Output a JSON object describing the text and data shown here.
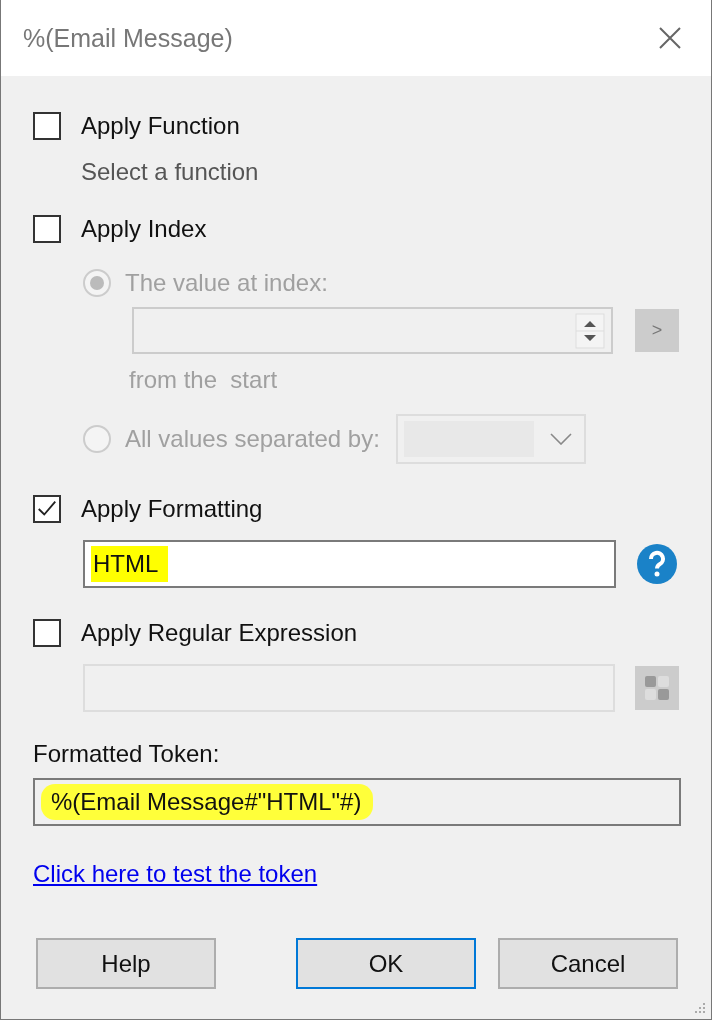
{
  "window": {
    "title": "%(Email Message)"
  },
  "apply_function": {
    "label": "Apply Function",
    "checked": false,
    "hint": "Select a function"
  },
  "apply_index": {
    "label": "Apply Index",
    "checked": false,
    "radios": [
      {
        "label": "The value at index:",
        "selected": true
      },
      {
        "label": "All values separated by:",
        "selected": false
      }
    ],
    "from_text": "from the  start",
    "next_button": ">"
  },
  "apply_formatting": {
    "label": "Apply Formatting",
    "checked": true,
    "value": "HTML",
    "highlighted": true
  },
  "apply_regex": {
    "label": "Apply Regular Expression",
    "checked": false
  },
  "formatted_token": {
    "label": "Formatted Token:",
    "value": "%(Email Message#\"HTML\"#)",
    "highlighted": true
  },
  "test_link": "Click here to test the token",
  "buttons": [
    {
      "label": "Help",
      "default": false
    },
    {
      "label": "OK",
      "default": true
    },
    {
      "label": "Cancel",
      "default": false
    }
  ]
}
